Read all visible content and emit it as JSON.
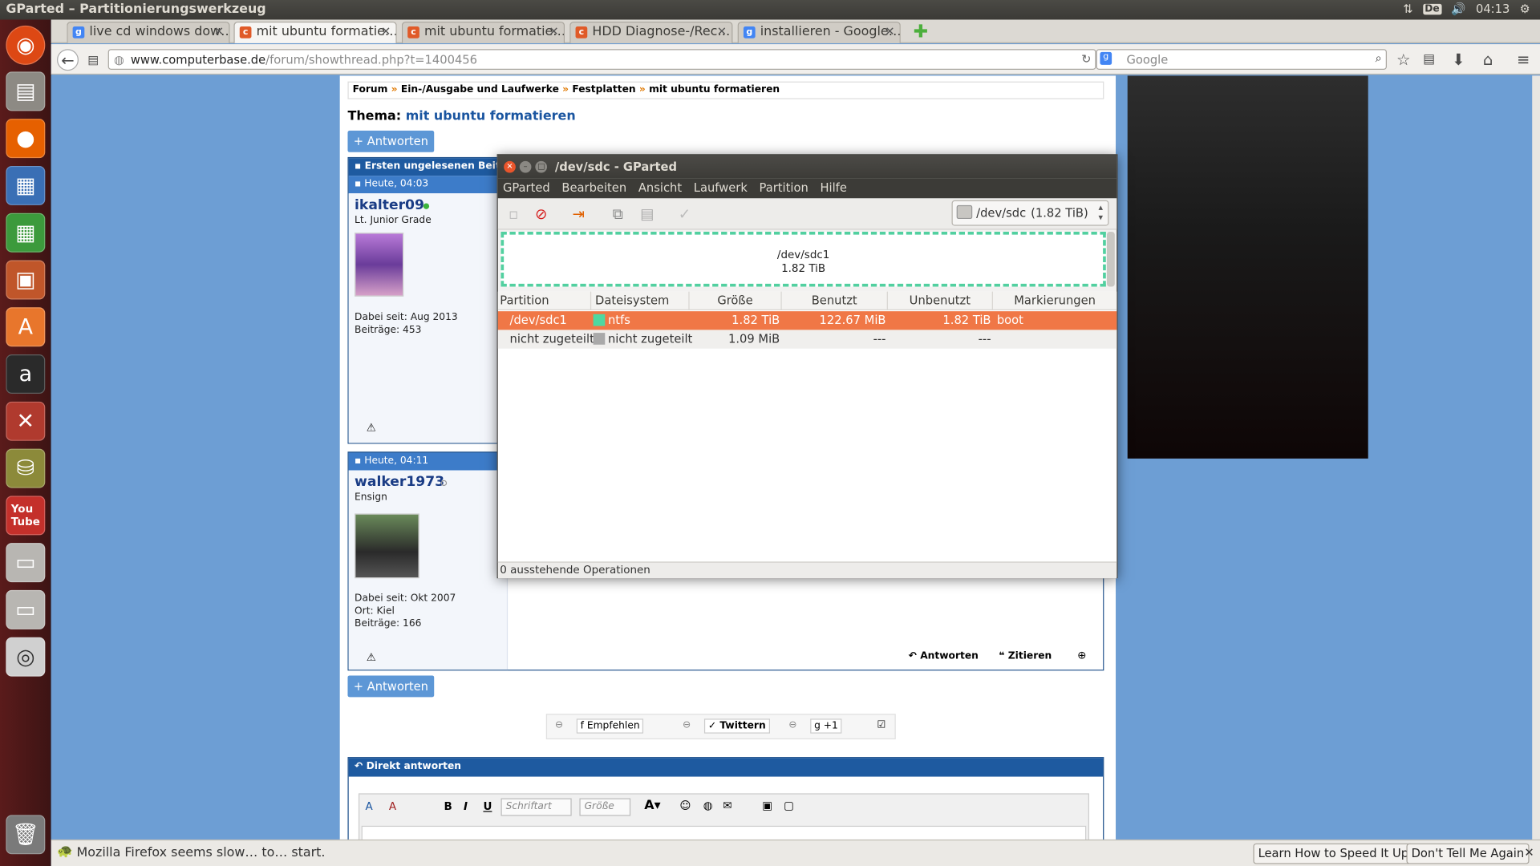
{
  "window_title": "GParted – Partitionierungswerkzeug",
  "tray": {
    "keyboard": "De",
    "time": "04:13"
  },
  "tabs": [
    {
      "label": "live cd windows dow…",
      "icon": "google"
    },
    {
      "label": "mit ubuntu formatie…",
      "icon": "computerbase",
      "active": true
    },
    {
      "label": "mit ubuntu formatie…",
      "icon": "computerbase"
    },
    {
      "label": "HDD Diagnose-/Rec…",
      "icon": "computerbase"
    },
    {
      "label": "installieren - Google…",
      "icon": "google"
    }
  ],
  "url": {
    "domain": "www.computerbase.de",
    "path": "/forum/showthread.php?t=1400456"
  },
  "search": {
    "placeholder": "Google"
  },
  "forum": {
    "breadcrumb": [
      "Forum",
      "Ein-/Ausgabe und Laufwerke",
      "Festplatten",
      "mit ubuntu formatieren"
    ],
    "thema_label": "Thema:",
    "thema_title": "mit ubuntu formatieren",
    "reply_label": "+ Antworten",
    "unread_label": "Ersten ungelesenen Beitra",
    "posts": [
      {
        "time": "Heute, 04:03",
        "user": "ikalter09",
        "rank": "Lt. Junior Grade",
        "since": "Dabei seit: Aug 2013",
        "posts": "Beiträge: 453"
      },
      {
        "time": "Heute, 04:11",
        "user": "walker1973",
        "rank": "Ensign",
        "since": "Dabei seit: Okt 2007",
        "location": "Ort: Kiel",
        "posts": "Beiträge: 166"
      }
    ],
    "actions": {
      "reply": "Antworten",
      "quote": "Zitieren"
    },
    "social": {
      "recommend": "Empfehlen",
      "tweet": "Twittern",
      "plus": "+1"
    },
    "direct_reply": "Direkt antworten",
    "editor": {
      "font": "Schriftart",
      "size": "Größe"
    }
  },
  "gparted": {
    "title": "/dev/sdc - GParted",
    "menu": [
      "GParted",
      "Bearbeiten",
      "Ansicht",
      "Laufwerk",
      "Partition",
      "Hilfe"
    ],
    "device": "/dev/sdc",
    "device_size": "(1.82 TiB)",
    "map_name": "/dev/sdc1",
    "map_size": "1.82 TiB",
    "columns": [
      "Partition",
      "Dateisystem",
      "Größe",
      "Benutzt",
      "Unbenutzt",
      "Markierungen"
    ],
    "rows": [
      {
        "partition": "/dev/sdc1",
        "fs": "ntfs",
        "size": "1.82 TiB",
        "used": "122.67 MiB",
        "unused": "1.82 TiB",
        "flags": "boot",
        "color": "#4ed8a0",
        "selected": true
      },
      {
        "partition": "nicht zugeteilt",
        "fs": "nicht zugeteilt",
        "size": "1.09 MiB",
        "used": "---",
        "unused": "---",
        "flags": "",
        "color": "#a9a9a9",
        "selected": false
      }
    ],
    "status": "0 ausstehende Operationen"
  },
  "notification": {
    "text": "Mozilla Firefox seems slow… to… start.",
    "btn1": "Learn How to Speed It Up",
    "btn2": "Don't Tell Me Again"
  }
}
